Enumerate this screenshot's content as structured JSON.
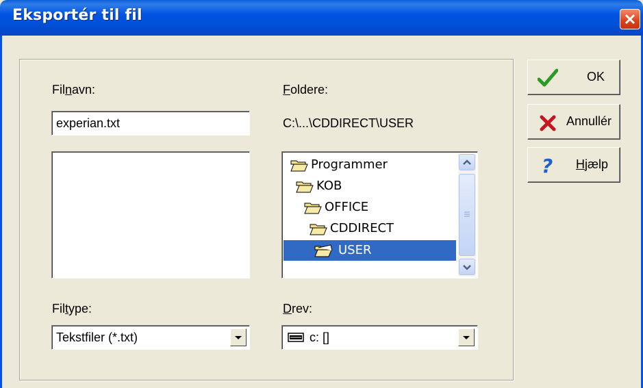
{
  "dialog": {
    "title": "Eksportér til fil"
  },
  "filename": {
    "label_pre": "Fil",
    "label_key": "n",
    "label_post": "avn:",
    "value": "experian.txt"
  },
  "folders": {
    "label_key": "F",
    "label_post": "oldere:",
    "path": "C:\\...\\CDDIRECT\\USER",
    "items": [
      {
        "label": "Programmer"
      },
      {
        "label": "KOB"
      },
      {
        "label": "OFFICE"
      },
      {
        "label": "CDDIRECT"
      },
      {
        "label": "USER",
        "selected": true
      }
    ]
  },
  "filetype": {
    "label_pre": "Fil",
    "label_key": "t",
    "label_post": "ype:",
    "selected": "Tekstfiler (*.txt)"
  },
  "drive": {
    "label_key": "D",
    "label_post": "rev:",
    "selected": "c: []"
  },
  "buttons": {
    "ok": "OK",
    "cancel": "Annullér",
    "help_key": "H",
    "help_post": "jælp"
  },
  "colors": {
    "titlebar": "#0054e3",
    "selection": "#316ac5",
    "dialog_bg": "#ece9d8",
    "ok_check": "#2a9a22",
    "cancel_x": "#c8141c",
    "help_q": "#1e5fd0"
  }
}
